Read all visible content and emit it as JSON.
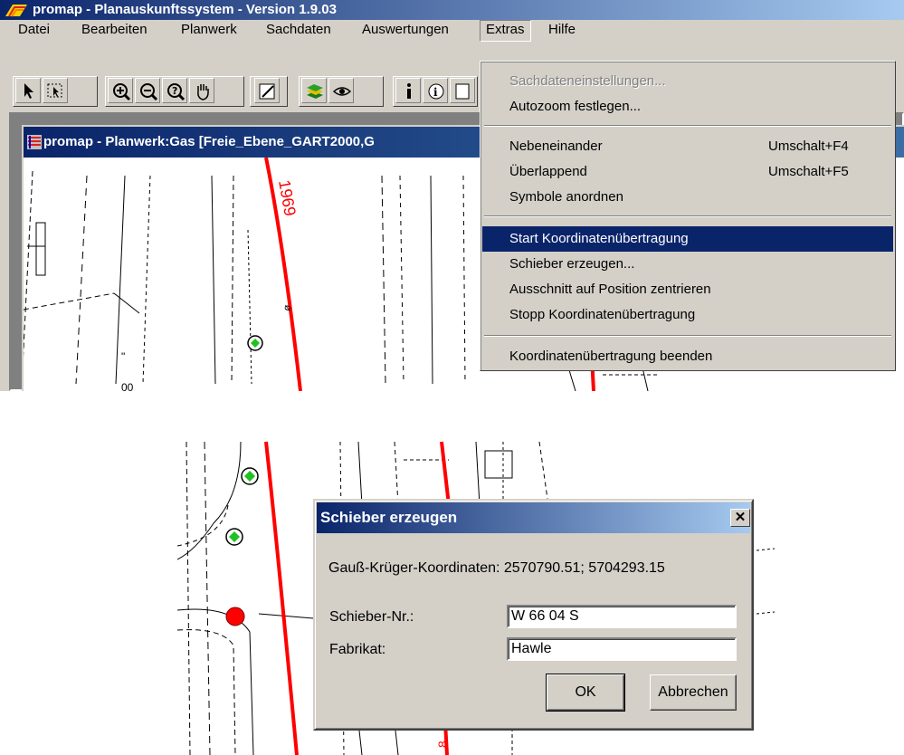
{
  "app": {
    "title": "promap - Planauskunftssystem - Version 1.9.03"
  },
  "menubar": {
    "items": [
      "Datei",
      "Bearbeiten",
      "Planwerk",
      "Sachdaten",
      "Auswertungen",
      "Extras",
      "Hilfe"
    ],
    "open_menu": "Extras"
  },
  "toolbar": {
    "tools": [
      "select-arrow-icon",
      "select-box-icon",
      "zoom-in-icon",
      "zoom-out-icon",
      "zoom-query-icon",
      "pan-hand-icon",
      "draw-icon",
      "layers-icon",
      "visibility-eye-icon",
      "info-icon",
      "info-small-icon",
      "window-icon"
    ]
  },
  "child_window": {
    "title": "promap - Planwerk:Gas [Freie_Ebene_GART2000,G"
  },
  "map_top": {
    "label_1969": "1969"
  },
  "extras_menu": {
    "items": [
      {
        "label": "Sachdateneinstellungen...",
        "shortcut": "",
        "disabled": true
      },
      {
        "label": "Autozoom festlegen...",
        "shortcut": ""
      },
      {
        "label": "Nebeneinander",
        "shortcut": "Umschalt+F4"
      },
      {
        "label": "Überlappend",
        "shortcut": "Umschalt+F5"
      },
      {
        "label": "Symbole anordnen",
        "shortcut": ""
      },
      {
        "label": "Start Koordinatenübertragung",
        "shortcut": "",
        "highlighted": true
      },
      {
        "label": "Schieber erzeugen...",
        "shortcut": ""
      },
      {
        "label": "Ausschnitt auf Position zentrieren",
        "shortcut": ""
      },
      {
        "label": "Stopp Koordinatenübertragung",
        "shortcut": ""
      },
      {
        "label": "Koordinatenübertragung beenden",
        "shortcut": ""
      }
    ]
  },
  "dialog": {
    "title": "Schieber erzeugen",
    "close_glyph": "✕",
    "coords_text": "Gauß-Krüger-Koordinaten: 2570790.51; 5704293.15",
    "schieber_label": "Schieber-Nr.:",
    "schieber_value": "W 66 04 S",
    "fabrikat_label": "Fabrikat:",
    "fabrikat_value": "Hawle",
    "ok_label": "OK",
    "cancel_label": "Abbrechen"
  },
  "colors": {
    "titlebar": "#0a246a",
    "highlight": "#0a246a",
    "pipe": "#ff0000",
    "valve_fill": "#ff0000",
    "valve_marker": "#22c022",
    "window_bg": "#d4d0c8"
  }
}
